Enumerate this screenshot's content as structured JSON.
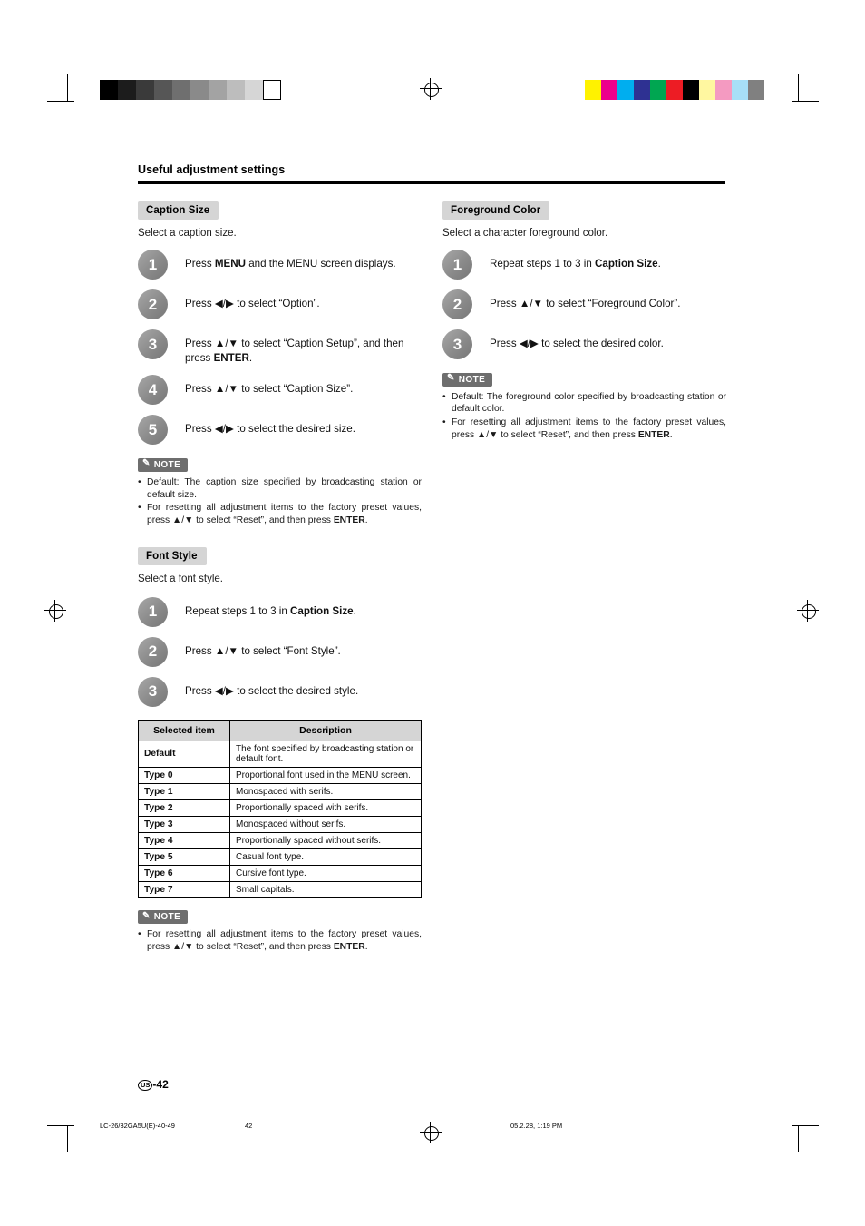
{
  "page": {
    "header": "Useful adjustment settings",
    "page_number": "-42",
    "page_badge": "US",
    "footer": {
      "left": "LC-26/32GA5U(E)-40-49",
      "center": "42",
      "right": "05.2.28, 1:19 PM"
    }
  },
  "color_bars": {
    "gray": [
      "#000000",
      "#1c1c1c",
      "#3a3a3a",
      "#565656",
      "#6f6f6f",
      "#8a8a8a",
      "#a3a3a3",
      "#bdbdbd",
      "#d6d6d6",
      "#ffffff"
    ],
    "color": [
      "#fff200",
      "#ec008c",
      "#00aeef",
      "#2e3192",
      "#00a651",
      "#ed1c24",
      "#000000",
      "#fff7a0",
      "#f49ac1",
      "#a7dff7",
      "#808080"
    ]
  },
  "sections": [
    {
      "id": "caption-size",
      "title": "Caption Size",
      "subtitle": "Select a caption size.",
      "steps": [
        {
          "n": "1",
          "html": "Press <b>MENU</b> and the MENU screen displays."
        },
        {
          "n": "2",
          "html": "Press ◀/▶ to select “Option”."
        },
        {
          "n": "3",
          "html": "Press ▲/▼ to select “Caption Setup”, and then press <b>ENTER</b>."
        },
        {
          "n": "4",
          "html": "Press ▲/▼ to select “Caption Size”."
        },
        {
          "n": "5",
          "html": "Press ◀/▶ to select the desired size."
        }
      ],
      "note_label": "NOTE",
      "notes": [
        "Default: The caption size specified by broadcasting station or default size.",
        "For resetting all adjustment items to the factory preset values, press ▲/▼ to select “Reset”, and then press <b>ENTER</b>."
      ]
    },
    {
      "id": "font-style",
      "title": "Font Style",
      "subtitle": "Select a font style.",
      "steps": [
        {
          "n": "1",
          "html": "Repeat steps 1 to 3 in <b>Caption Size</b>."
        },
        {
          "n": "2",
          "html": "Press ▲/▼ to select “Font Style”."
        },
        {
          "n": "3",
          "html": "Press ◀/▶ to select the desired style."
        }
      ],
      "table": {
        "headers": [
          "Selected item",
          "Description"
        ],
        "rows": [
          [
            "Default",
            "The font specified by broadcasting station or default font."
          ],
          [
            "Type 0",
            "Proportional font used in the MENU screen."
          ],
          [
            "Type 1",
            "Monospaced with serifs."
          ],
          [
            "Type 2",
            "Proportionally spaced with serifs."
          ],
          [
            "Type 3",
            "Monospaced without serifs."
          ],
          [
            "Type 4",
            "Proportionally spaced without serifs."
          ],
          [
            "Type 5",
            "Casual font type."
          ],
          [
            "Type 6",
            "Cursive font type."
          ],
          [
            "Type 7",
            "Small capitals."
          ]
        ]
      },
      "note_label": "NOTE",
      "notes": [
        "For resetting all adjustment items to the factory preset values, press ▲/▼ to select “Reset”, and then press <b>ENTER</b>."
      ]
    },
    {
      "id": "foreground-color",
      "title": "Foreground Color",
      "subtitle": "Select a character foreground color.",
      "steps": [
        {
          "n": "1",
          "html": "Repeat steps 1 to 3 in <b>Caption Size</b>."
        },
        {
          "n": "2",
          "html": "Press ▲/▼ to select “Foreground Color”."
        },
        {
          "n": "3",
          "html": "Press ◀/▶ to select the desired color."
        }
      ],
      "note_label": "NOTE",
      "notes": [
        "Default: The foreground color specified by broadcasting station or default color.",
        "For resetting all adjustment items to the factory preset values, press ▲/▼ to select “Reset”, and then press <b>ENTER</b>."
      ]
    }
  ]
}
